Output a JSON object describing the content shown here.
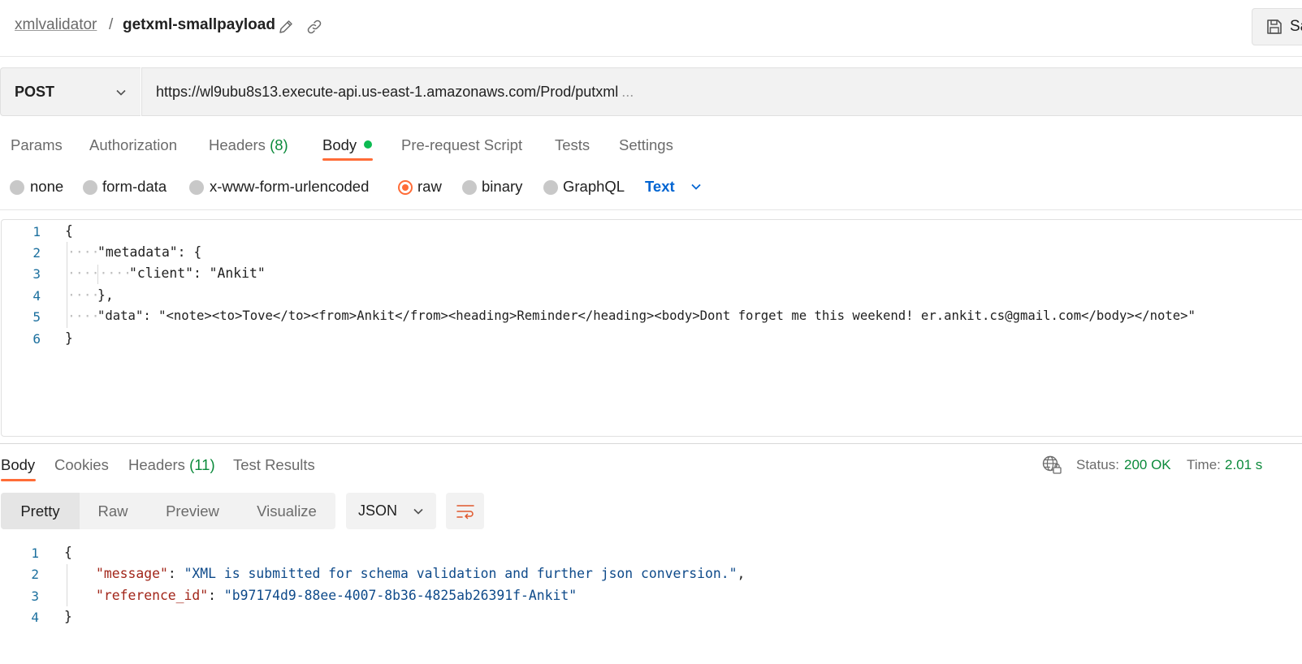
{
  "header": {
    "collection": "xmlvalidator",
    "separator": "/",
    "request_name": "getxml-smallpayload",
    "save_label": "Sa"
  },
  "request": {
    "method": "POST",
    "url": "https://wl9ubu8s13.execute-api.us-east-1.amazonaws.com/Prod/putxml",
    "url_overflow": "..."
  },
  "request_tabs": {
    "params": "Params",
    "authorization": "Authorization",
    "headers": "Headers",
    "headers_count": "(8)",
    "body": "Body",
    "pre_request": "Pre-request Script",
    "tests": "Tests",
    "settings": "Settings"
  },
  "body_types": {
    "none": "none",
    "form_data": "form-data",
    "urlencoded": "x-www-form-urlencoded",
    "raw": "raw",
    "binary": "binary",
    "graphql": "GraphQL",
    "selected": "raw",
    "language": "Text"
  },
  "request_body": {
    "line_numbers": [
      "1",
      "2",
      "3",
      "4",
      "5",
      "6"
    ],
    "lines": [
      "{",
      "\"metadata\": {",
      "\"client\": \"Ankit\"",
      "},",
      "\"data\": \"<note><to>Tove</to><from>Ankit</from><heading>Reminder</heading><body>Dont forget me this weekend! er.ankit.cs@gmail.com</body></note>\"",
      "}"
    ]
  },
  "response_tabs": {
    "body": "Body",
    "cookies": "Cookies",
    "headers": "Headers",
    "headers_count": "(11)",
    "test_results": "Test Results"
  },
  "response_meta": {
    "status_label": "Status:",
    "status_value": "200 OK",
    "time_label": "Time:",
    "time_value": "2.01 s"
  },
  "response_view": {
    "pretty": "Pretty",
    "raw": "Raw",
    "preview": "Preview",
    "visualize": "Visualize",
    "format": "JSON"
  },
  "response_body": {
    "line_numbers": [
      "1",
      "2",
      "3",
      "4"
    ],
    "open": "{",
    "message_key": "\"message\"",
    "message_value": "\"XML is submitted for schema validation and further json conversion.\"",
    "ref_key": "\"reference_id\"",
    "ref_value": "\"b97174d9-88ee-4007-8b36-4825ab26391f-Ankit\"",
    "close": "}"
  },
  "colors": {
    "accent": "#ff6c37",
    "success": "#0b8a3b",
    "link": "#0265d2",
    "json_key": "#a2261a",
    "json_string": "#0e4a8a"
  }
}
